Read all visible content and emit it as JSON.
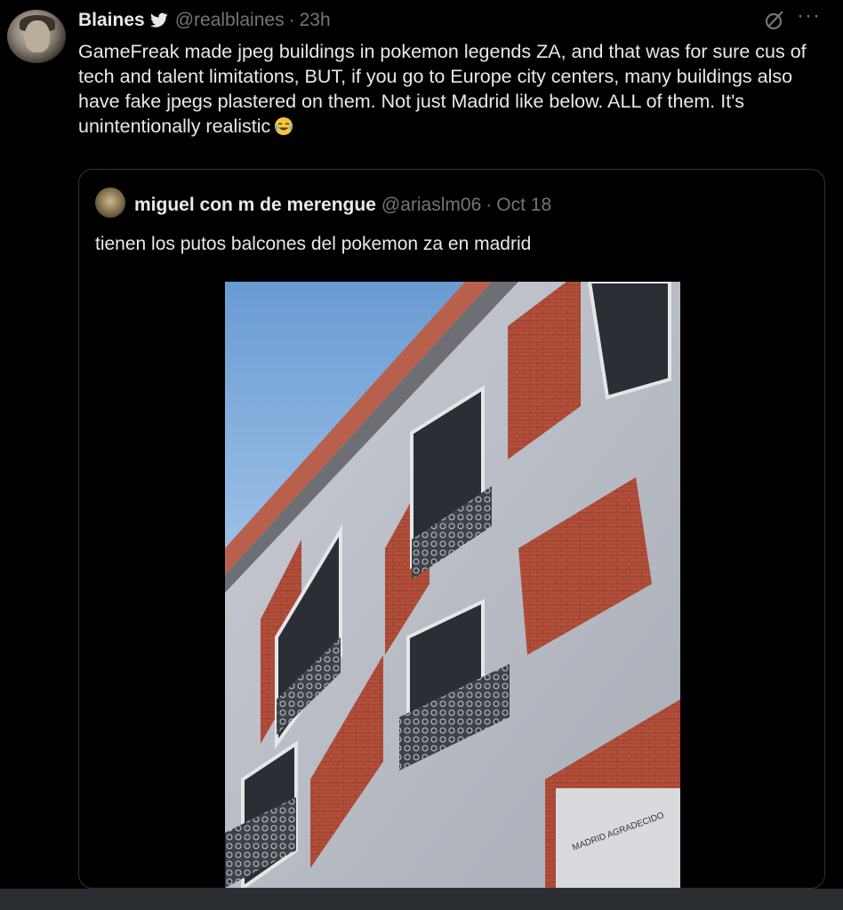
{
  "tweet": {
    "author_name": "Blaines",
    "author_handle": "@realblaines",
    "separator": "·",
    "time": "23h",
    "more_label": "···",
    "text": "GameFreak made jpeg buildings in pokemon legends ZA, and that was for sure cus of tech and talent limitations, BUT, if you go to Europe city centers, many buildings also have fake jpegs plastered on them. Not just Madrid like below. ALL of them. It's unintentionally realistic",
    "icons": {
      "verified": "bird-icon",
      "grok": "grok-icon",
      "emoji": "face-with-tears-of-joy-icon"
    }
  },
  "quote": {
    "author_name": "miguel con m de merengue",
    "author_handle": "@ariaslm06",
    "separator": "·",
    "date": "Oct 18",
    "text": "tienen los putos balcones del pokemon za en madrid"
  },
  "photo": {
    "plaque_text": "MADRID AGRADECIDO"
  },
  "colors": {
    "background": "#000000",
    "text": "#e7e9ea",
    "muted": "#71767b",
    "border": "#2f3336",
    "brick": "#b5523e",
    "sky": "#6e9fd6"
  }
}
